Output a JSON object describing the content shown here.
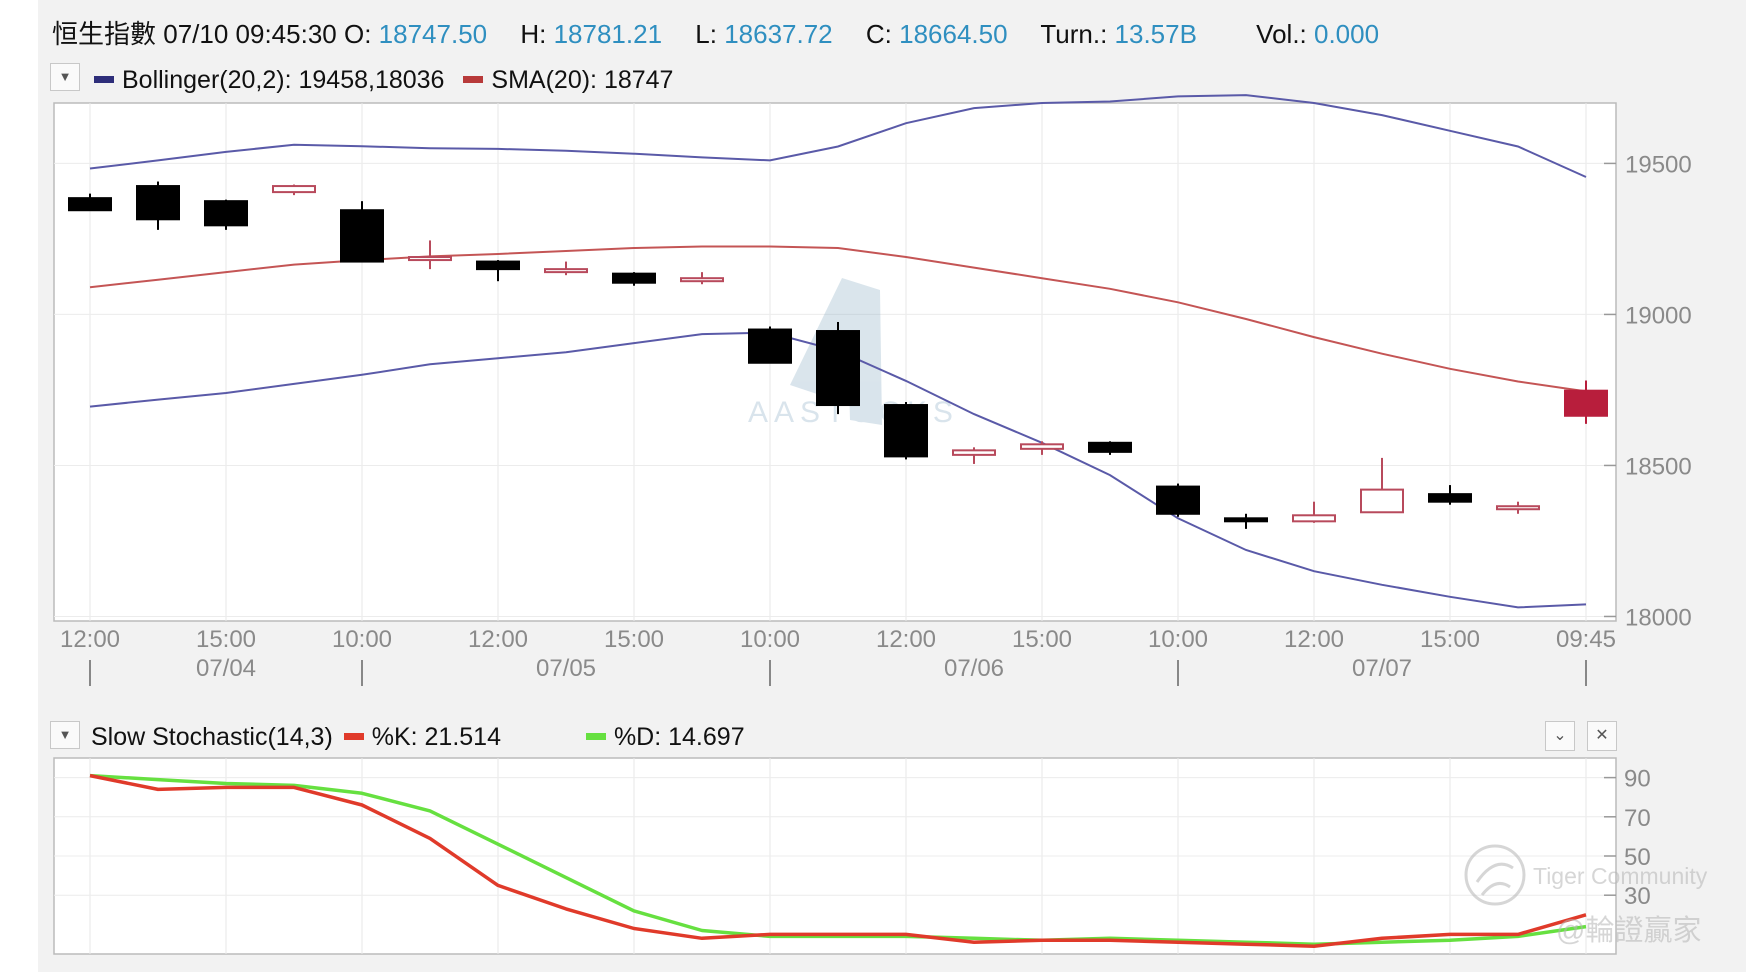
{
  "quote": {
    "name": "恒生指數",
    "datetime": "07/10 09:45:30",
    "open_label": "O:",
    "open": "18747.50",
    "high_label": "H:",
    "high": "18781.21",
    "low_label": "L:",
    "low": "18637.72",
    "close_label": "C:",
    "close": "18664.50",
    "turnover_label": "Turn.:",
    "turnover": "13.57B",
    "volume_label": "Vol.:",
    "volume": "0.000"
  },
  "main_legend": {
    "bollinger_label": "Bollinger(20,2): 19458,18036",
    "sma_label": "SMA(20): 18747"
  },
  "stoch_legend": {
    "title": "Slow Stochastic(14,3)",
    "k_label": "%K: 21.514",
    "d_label": "%D: 14.697"
  },
  "dropdown_glyph": "▼",
  "collapse_glyph": "⌄",
  "close_glyph": "✕",
  "watermarks": {
    "center": "AASTOCKS",
    "community": "Tiger Community",
    "handle": "@輪證贏家"
  },
  "colors": {
    "value_blue": "#2f8fc0",
    "bollinger": "#5a5aa8",
    "sma": "#c45555",
    "up_candle": "#b84a5c",
    "down_candle": "#000000",
    "last_candle": "#b81e3c",
    "stoch_k": "#e03a2a",
    "stoch_d": "#66e040"
  },
  "chart_data": [
    {
      "type": "candlestick",
      "ylim": [
        17985,
        19700
      ],
      "y_ticks": [
        19500,
        19000,
        18500,
        18000
      ],
      "x_tick_labels": [
        "12:00",
        "15:00",
        "10:00",
        "12:00",
        "15:00",
        "10:00",
        "12:00",
        "15:00",
        "10:00",
        "12:00",
        "15:00",
        "09:45"
      ],
      "x_date_labels": [
        "07/04",
        "07/05",
        "07/06",
        "07/07"
      ],
      "candles": [
        {
          "o": 19385,
          "h": 19400,
          "l": 19345,
          "c": 19345
        },
        {
          "o": 19425,
          "h": 19440,
          "l": 19280,
          "c": 19315
        },
        {
          "o": 19375,
          "h": 19380,
          "l": 19280,
          "c": 19295
        },
        {
          "o": 19405,
          "h": 19430,
          "l": 19395,
          "c": 19425
        },
        {
          "o": 19345,
          "h": 19375,
          "l": 19175,
          "c": 19175
        },
        {
          "o": 19180,
          "h": 19245,
          "l": 19150,
          "c": 19190
        },
        {
          "o": 19175,
          "h": 19180,
          "l": 19110,
          "c": 19150
        },
        {
          "o": 19150,
          "h": 19175,
          "l": 19130,
          "c": 19150
        },
        {
          "o": 19135,
          "h": 19140,
          "l": 19095,
          "c": 19105
        },
        {
          "o": 19120,
          "h": 19140,
          "l": 19100,
          "c": 19120
        },
        {
          "o": 18950,
          "h": 18960,
          "l": 18840,
          "c": 18840
        },
        {
          "o": 18945,
          "h": 18975,
          "l": 18670,
          "c": 18700
        },
        {
          "o": 18700,
          "h": 18710,
          "l": 18520,
          "c": 18530
        },
        {
          "o": 18535,
          "h": 18560,
          "l": 18505,
          "c": 18550
        },
        {
          "o": 18555,
          "h": 18580,
          "l": 18535,
          "c": 18570
        },
        {
          "o": 18575,
          "h": 18580,
          "l": 18535,
          "c": 18545
        },
        {
          "o": 18430,
          "h": 18440,
          "l": 18330,
          "c": 18340
        },
        {
          "o": 18325,
          "h": 18340,
          "l": 18290,
          "c": 18320
        },
        {
          "o": 18315,
          "h": 18380,
          "l": 18310,
          "c": 18335
        },
        {
          "o": 18345,
          "h": 18525,
          "l": 18345,
          "c": 18420
        },
        {
          "o": 18405,
          "h": 18435,
          "l": 18370,
          "c": 18380
        },
        {
          "o": 18365,
          "h": 18380,
          "l": 18340,
          "c": 18365
        },
        {
          "o": 18747.5,
          "h": 18781.21,
          "l": 18637.72,
          "c": 18664.5
        }
      ],
      "series": [
        {
          "name": "Bollinger Upper",
          "values": [
            19483,
            19510,
            19538,
            19562,
            19557,
            19550,
            19548,
            19542,
            19532,
            19520,
            19510,
            19556,
            19633,
            19683,
            19700,
            19705,
            19722,
            19726,
            19700,
            19660,
            19608,
            19556,
            19455
          ]
        },
        {
          "name": "SMA(20)",
          "values": [
            19090,
            19115,
            19140,
            19165,
            19180,
            19192,
            19200,
            19210,
            19220,
            19225,
            19225,
            19220,
            19190,
            19155,
            19120,
            19085,
            19040,
            18985,
            18925,
            18870,
            18820,
            18778,
            18745
          ]
        },
        {
          "name": "Bollinger Lower",
          "values": [
            18695,
            18718,
            18740,
            18770,
            18800,
            18835,
            18855,
            18875,
            18905,
            18935,
            18940,
            18880,
            18780,
            18670,
            18575,
            18468,
            18325,
            18220,
            18150,
            18105,
            18065,
            18030,
            18040
          ]
        }
      ]
    },
    {
      "type": "line",
      "ylim": [
        0,
        100
      ],
      "y_ticks": [
        90,
        70,
        50,
        30
      ],
      "series": [
        {
          "name": "%K",
          "values": [
            91,
            84,
            85,
            85,
            76,
            59,
            35,
            23,
            13,
            8,
            10,
            10,
            10,
            6,
            7,
            7,
            6,
            5,
            4,
            8,
            10,
            10,
            20
          ]
        },
        {
          "name": "%D",
          "values": [
            91,
            89,
            87,
            86,
            82,
            73,
            56,
            39,
            22,
            12,
            9,
            9,
            9,
            8,
            7,
            8,
            7,
            6,
            5,
            6,
            7,
            9,
            14
          ]
        }
      ]
    }
  ]
}
